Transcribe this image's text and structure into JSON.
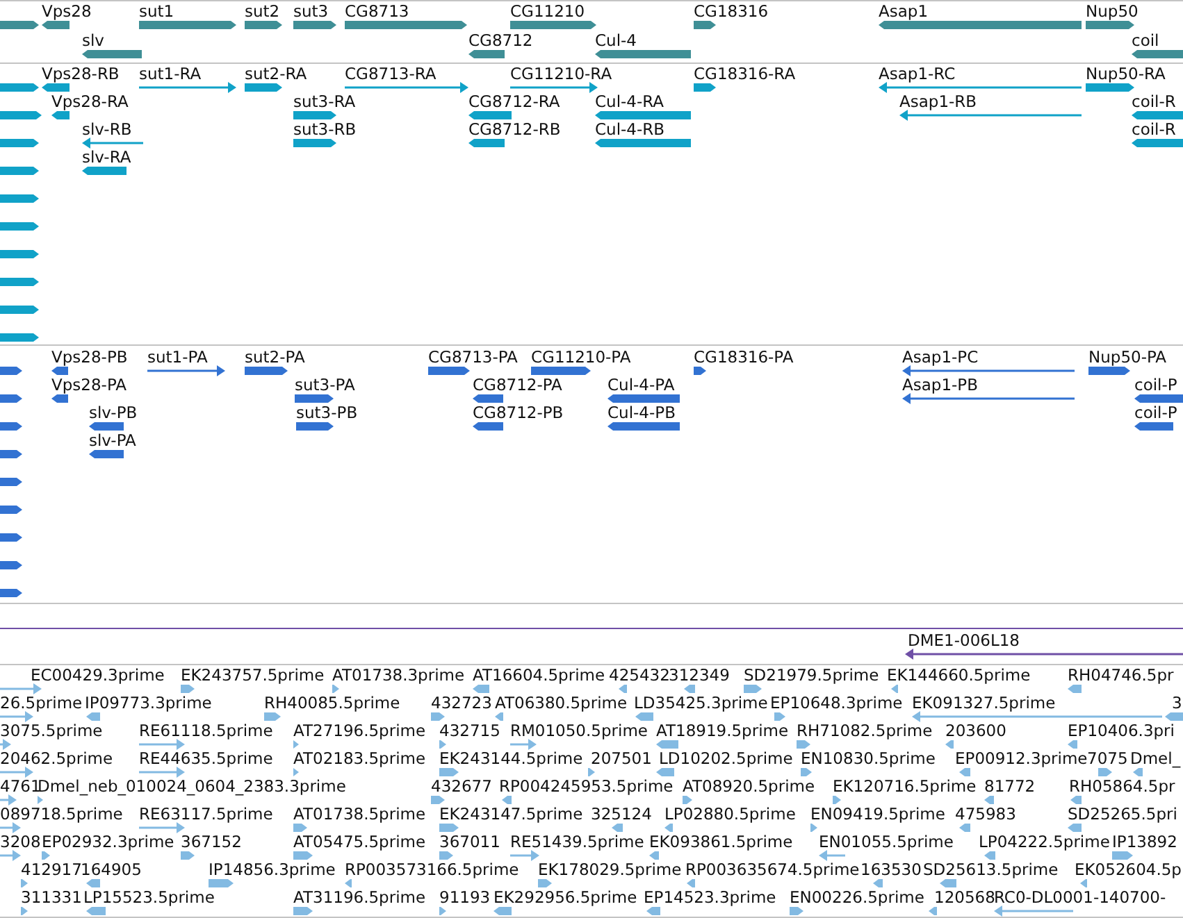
{
  "tracks": [
    {
      "kind": "gene",
      "features": [
        {
          "reverse": false
        },
        {
          "label": "Vps28",
          "reverse": true
        },
        {
          "label": "sut1",
          "reverse": false
        },
        {
          "label": "sut2",
          "reverse": false
        },
        {
          "label": "sut3",
          "reverse": false
        },
        {
          "label": "CG8713",
          "reverse": false
        },
        {
          "label": "CG11210",
          "reverse": false
        },
        {
          "label": "CG18316",
          "reverse": false
        },
        {
          "label": "Asap1",
          "reverse": true
        },
        {
          "label": "Nup50",
          "reverse": false
        },
        {
          "label": "slv",
          "reverse": true
        },
        {
          "label": "CG8712",
          "reverse": true
        },
        {
          "label": "Cul-4",
          "reverse": true
        },
        {
          "label": "coil",
          "reverse": true
        }
      ]
    },
    {
      "kind": "transcript",
      "features": [
        {
          "reverse": false
        },
        {
          "label": "Vps28-RB",
          "reverse": true
        },
        {
          "label": "sut1-RA",
          "reverse": false
        },
        {
          "label": "sut2-RA",
          "reverse": false
        },
        {
          "label": "CG8713-RA",
          "reverse": false
        },
        {
          "label": "CG11210-RA",
          "reverse": false
        },
        {
          "label": "CG18316-RA",
          "reverse": false
        },
        {
          "label": "Asap1-RC",
          "reverse": true
        },
        {
          "label": "Nup50-RA",
          "reverse": false
        },
        {
          "reverse": false
        },
        {
          "label": "Vps28-RA",
          "reverse": true
        },
        {
          "label": "sut3-RA",
          "reverse": false
        },
        {
          "label": "CG8712-RA",
          "reverse": true
        },
        {
          "label": "Cul-4-RA",
          "reverse": true
        },
        {
          "label": "Asap1-RB",
          "reverse": true
        },
        {
          "label": "coil-R",
          "reverse": true
        },
        {
          "reverse": false
        },
        {
          "label": "slv-RB",
          "reverse": true
        },
        {
          "label": "sut3-RB",
          "reverse": false
        },
        {
          "label": "CG8712-RB",
          "reverse": true
        },
        {
          "label": "Cul-4-RB",
          "reverse": true
        },
        {
          "label": "coil-R",
          "reverse": true
        },
        {
          "reverse": false
        },
        {
          "label": "slv-RA",
          "reverse": true
        },
        {
          "reverse": false
        },
        {
          "reverse": false
        },
        {
          "reverse": false
        },
        {
          "reverse": false
        },
        {
          "reverse": false
        },
        {
          "reverse": false
        }
      ]
    },
    {
      "kind": "protein",
      "features": [
        {
          "reverse": false
        },
        {
          "label": "Vps28-PB",
          "reverse": true
        },
        {
          "label": "sut1-PA",
          "reverse": false
        },
        {
          "label": "sut2-PA",
          "reverse": false
        },
        {
          "label": "CG8713-PA",
          "reverse": false
        },
        {
          "label": "CG11210-PA",
          "reverse": false
        },
        {
          "label": "CG18316-PA",
          "reverse": false
        },
        {
          "label": "Asap1-PC",
          "reverse": true
        },
        {
          "label": "Nup50-PA",
          "reverse": false
        },
        {
          "reverse": false
        },
        {
          "label": "Vps28-PA",
          "reverse": true
        },
        {
          "label": "sut3-PA",
          "reverse": false
        },
        {
          "label": "CG8712-PA",
          "reverse": true
        },
        {
          "label": "Cul-4-PA",
          "reverse": true
        },
        {
          "label": "Asap1-PB",
          "reverse": true
        },
        {
          "label": "coil-P",
          "reverse": true
        },
        {
          "reverse": false
        },
        {
          "label": "slv-PB",
          "reverse": true
        },
        {
          "label": "sut3-PB",
          "reverse": false
        },
        {
          "label": "CG8712-PB",
          "reverse": true
        },
        {
          "label": "Cul-4-PB",
          "reverse": true
        },
        {
          "label": "coil-P",
          "reverse": true
        },
        {
          "reverse": false
        },
        {
          "label": "slv-PA",
          "reverse": true
        },
        {
          "reverse": false
        },
        {
          "reverse": false
        },
        {
          "reverse": false
        },
        {
          "reverse": false
        },
        {
          "reverse": false
        }
      ]
    },
    {
      "kind": "clone",
      "features": [
        {
          "label": "DME1-006L18",
          "reverse": true
        }
      ]
    },
    {
      "kind": "est",
      "features": [
        {
          "label": "EC00429.3prime",
          "reverse": false
        },
        {
          "label": "EK243757.5prime",
          "reverse": false
        },
        {
          "label": "AT01738.3prime",
          "reverse": false
        },
        {
          "label": "AT16604.5prime",
          "reverse": true
        },
        {
          "label": "425432",
          "reverse": true
        },
        {
          "label": "312349",
          "reverse": true
        },
        {
          "label": "SD21979.5prime",
          "reverse": false
        },
        {
          "label": "EK144660.5prime",
          "reverse": true
        },
        {
          "label": "RH04746.5pr",
          "reverse": true
        },
        {
          "label": "26.5prime",
          "reverse": false
        },
        {
          "label": "IP09773.3prime",
          "reverse": true
        },
        {
          "label": "RH40085.5prime",
          "reverse": false
        },
        {
          "label": "432723",
          "reverse": false
        },
        {
          "label": "AT06380.5prime",
          "reverse": true
        },
        {
          "label": "LD35425.3prime",
          "reverse": true
        },
        {
          "label": "EP10648.3prime",
          "reverse": false
        },
        {
          "label": "EK091327.5prime",
          "reverse": true
        },
        {
          "label": "3",
          "reverse": true
        },
        {
          "label": "3075.5prime",
          "reverse": false
        },
        {
          "label": "RE61118.5prime",
          "reverse": false
        },
        {
          "label": "AT27196.5prime",
          "reverse": false
        },
        {
          "label": "432715",
          "reverse": false
        },
        {
          "label": "RM01050.5prime",
          "reverse": false
        },
        {
          "label": "AT18919.5prime",
          "reverse": true
        },
        {
          "label": "RH71082.5prime",
          "reverse": false
        },
        {
          "label": "203600",
          "reverse": true
        },
        {
          "label": "EP10406.3pri",
          "reverse": true
        },
        {
          "label": "20462.5prime",
          "reverse": false
        },
        {
          "label": "RE44635.5prime",
          "reverse": false
        },
        {
          "label": "AT02183.5prime",
          "reverse": false
        },
        {
          "label": "EK243144.5prime",
          "reverse": false
        },
        {
          "label": "207501",
          "reverse": false
        },
        {
          "label": "LD10202.5prime",
          "reverse": true
        },
        {
          "label": "EN10830.5prime",
          "reverse": false
        },
        {
          "label": "EP00912.3prime",
          "reverse": true
        },
        {
          "label": "7075",
          "reverse": false
        },
        {
          "label": "Dmel_",
          "reverse": true
        },
        {
          "label": "4761",
          "reverse": false
        },
        {
          "label": "Dmel_neb_010024_0604_2383.3prime",
          "reverse": false
        },
        {
          "label": "432677",
          "reverse": false
        },
        {
          "label": "RP004245953.5prime",
          "reverse": true
        },
        {
          "label": "AT08920.5prime",
          "reverse": false
        },
        {
          "label": "EK120716.5prime",
          "reverse": false
        },
        {
          "label": "81772",
          "reverse": true
        },
        {
          "label": "RH05864.5pr",
          "reverse": true
        },
        {
          "label": "089718.5prime",
          "reverse": false
        },
        {
          "label": "RE63117.5prime",
          "reverse": false
        },
        {
          "label": "AT01738.5prime",
          "reverse": false
        },
        {
          "label": "EK243147.5prime",
          "reverse": false
        },
        {
          "label": "325124",
          "reverse": true
        },
        {
          "label": "LP02880.5prime",
          "reverse": true
        },
        {
          "label": "EN09419.5prime",
          "reverse": false
        },
        {
          "label": "475983",
          "reverse": true
        },
        {
          "label": "SD25265.5pri",
          "reverse": true
        },
        {
          "label": "3208",
          "reverse": false
        },
        {
          "label": "EP02932.3prime",
          "reverse": false
        },
        {
          "label": "367152",
          "reverse": false
        },
        {
          "label": "AT05475.5prime",
          "reverse": false
        },
        {
          "label": "367011",
          "reverse": false
        },
        {
          "label": "RE51439.5prime",
          "reverse": false
        },
        {
          "label": "EK093861.5prime",
          "reverse": true
        },
        {
          "label": "EN01055.5prime",
          "reverse": true
        },
        {
          "label": "LP04222.5prime",
          "reverse": true
        },
        {
          "label": "IP13892",
          "reverse": false
        },
        {
          "label": "412917",
          "reverse": false
        },
        {
          "label": "164905",
          "reverse": true
        },
        {
          "label": "IP14856.3prime",
          "reverse": false
        },
        {
          "label": "RP003573166.5prime",
          "reverse": true
        },
        {
          "label": "EK178029.5prime",
          "reverse": false
        },
        {
          "label": "RP003635674.5prime",
          "reverse": true
        },
        {
          "label": "163530",
          "reverse": true
        },
        {
          "label": "SD25613.5prime",
          "reverse": true
        },
        {
          "label": "EK052604.5p",
          "reverse": true
        },
        {
          "label": "311331",
          "reverse": false
        },
        {
          "label": "LP15523.5prime",
          "reverse": true
        },
        {
          "label": "AT31196.5prime",
          "reverse": false
        },
        {
          "label": "91193",
          "reverse": false
        },
        {
          "label": "EK292956.5prime",
          "reverse": true
        },
        {
          "label": "EP14523.3prime",
          "reverse": true
        },
        {
          "label": "EN00226.5prime",
          "reverse": false
        },
        {
          "label": "120568",
          "reverse": true
        },
        {
          "label": "RC0-DL0001-140700-",
          "reverse": true
        }
      ]
    }
  ]
}
